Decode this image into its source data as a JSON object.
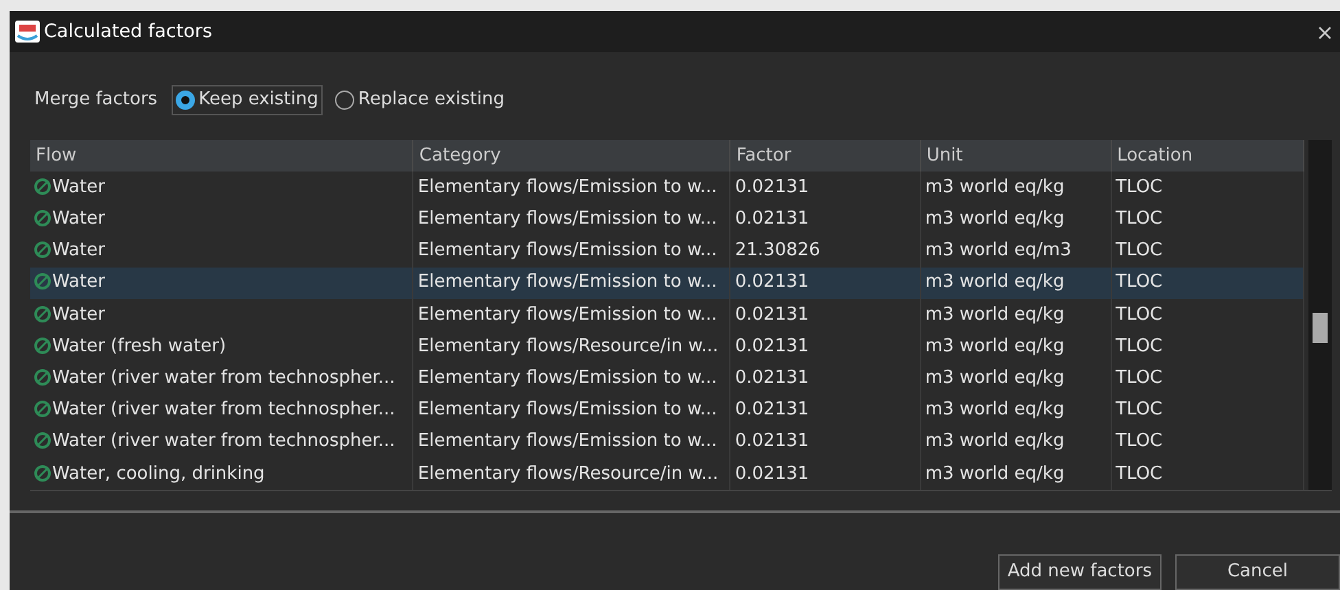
{
  "window": {
    "title": "Calculated factors"
  },
  "merge": {
    "label": "Merge factors",
    "options": [
      {
        "label": "Keep existing",
        "selected": true
      },
      {
        "label": "Replace existing",
        "selected": false
      }
    ]
  },
  "table": {
    "columns": [
      "Flow",
      "Category",
      "Factor",
      "Unit",
      "Location"
    ],
    "rows": [
      {
        "cells": [
          "Water",
          "Elementary flows/Emission to w...",
          "0.02131",
          "m3 world eq/kg",
          "TLOC"
        ],
        "selected": false
      },
      {
        "cells": [
          "Water",
          "Elementary flows/Emission to w...",
          "0.02131",
          "m3 world eq/kg",
          "TLOC"
        ],
        "selected": false
      },
      {
        "cells": [
          "Water",
          "Elementary flows/Emission to w...",
          "21.30826",
          "m3 world eq/m3",
          "TLOC"
        ],
        "selected": false
      },
      {
        "cells": [
          "Water",
          "Elementary flows/Emission to w...",
          "0.02131",
          "m3 world eq/kg",
          "TLOC"
        ],
        "selected": true
      },
      {
        "cells": [
          "Water",
          "Elementary flows/Emission to w...",
          "0.02131",
          "m3 world eq/kg",
          "TLOC"
        ],
        "selected": false
      },
      {
        "cells": [
          "Water (fresh water)",
          "Elementary flows/Resource/in w...",
          "0.02131",
          "m3 world eq/kg",
          "TLOC"
        ],
        "selected": false
      },
      {
        "cells": [
          "Water (river water from technospher...",
          "Elementary flows/Emission to w...",
          "0.02131",
          "m3 world eq/kg",
          "TLOC"
        ],
        "selected": false
      },
      {
        "cells": [
          "Water (river water from technospher...",
          "Elementary flows/Emission to w...",
          "0.02131",
          "m3 world eq/kg",
          "TLOC"
        ],
        "selected": false
      },
      {
        "cells": [
          "Water (river water from technospher...",
          "Elementary flows/Emission to w...",
          "0.02131",
          "m3 world eq/kg",
          "TLOC"
        ],
        "selected": false
      },
      {
        "cells": [
          "Water, cooling, drinking",
          "Elementary flows/Resource/in w...",
          "0.02131",
          "m3 world eq/kg",
          "TLOC"
        ],
        "selected": false
      }
    ]
  },
  "buttons": [
    {
      "label": "Add new factors"
    },
    {
      "label": "Cancel"
    }
  ]
}
